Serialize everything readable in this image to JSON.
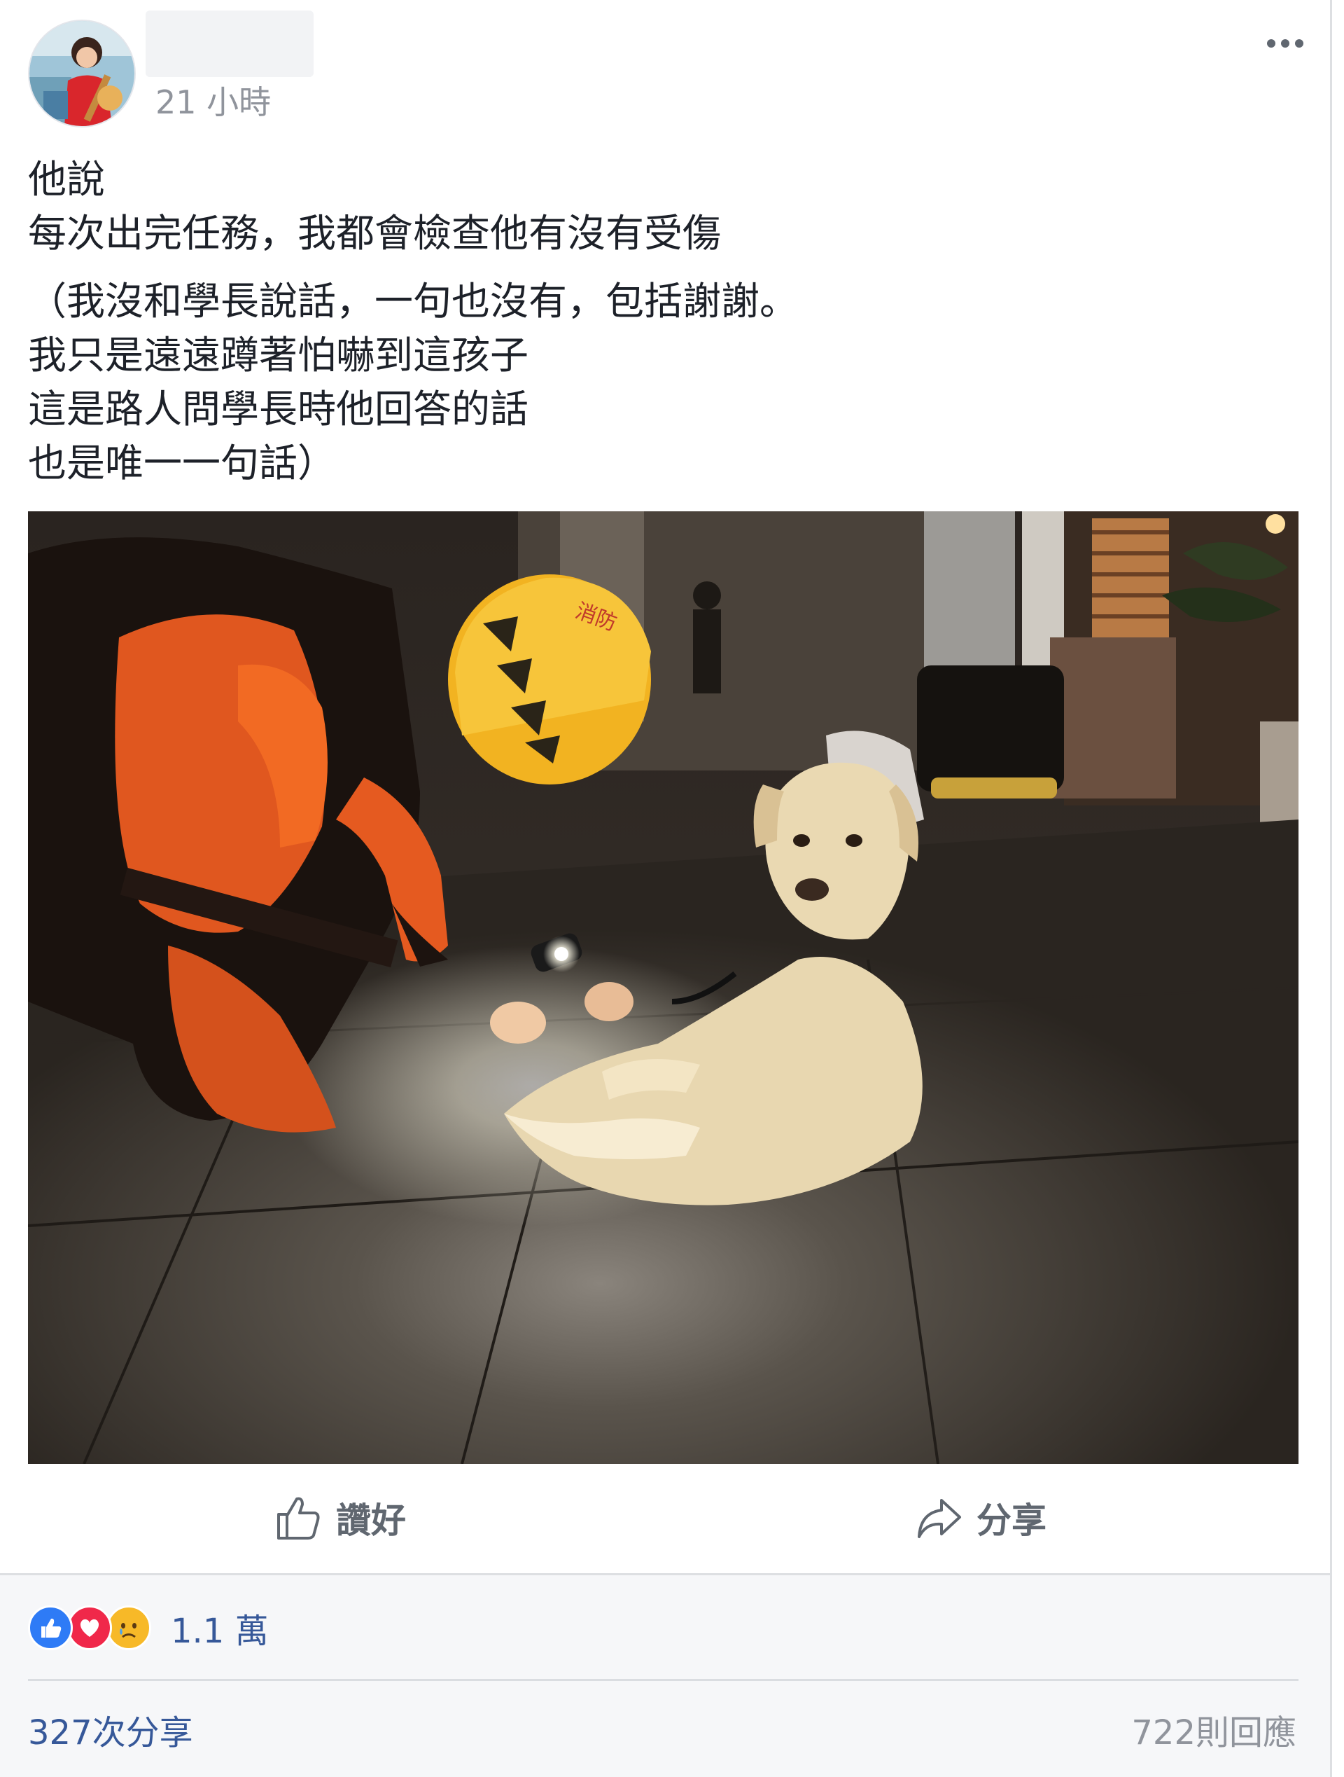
{
  "post": {
    "timestamp": "21 小時",
    "text_lines_1": [
      "他說",
      "每次出完任務，我都會檢查他有沒有受傷"
    ],
    "text_lines_2": [
      "（我沒和學長說話，一句也沒有，包括謝謝。",
      "我只是遠遠蹲著怕嚇到這孩子",
      "這是路人問學長時他回答的話",
      "也是唯一一句話）"
    ]
  },
  "icons": {
    "more": "more-options-icon",
    "like": "thumbs-up-icon",
    "share": "share-arrow-icon",
    "reaction_like": "like-reaction-icon",
    "reaction_love": "love-reaction-icon",
    "reaction_sad": "sad-reaction-icon"
  },
  "actions": {
    "like_label": "讚好",
    "share_label": "分享"
  },
  "stats": {
    "reactions": "1.1 萬",
    "shares": "327次分享",
    "comments": "722則回應"
  },
  "colors": {
    "link_blue": "#365899",
    "muted_gray": "#90949c",
    "action_gray": "#606770",
    "like_blue": "#2e7bf6",
    "love_red": "#f0284a",
    "sad_yellow": "#f7b928"
  }
}
